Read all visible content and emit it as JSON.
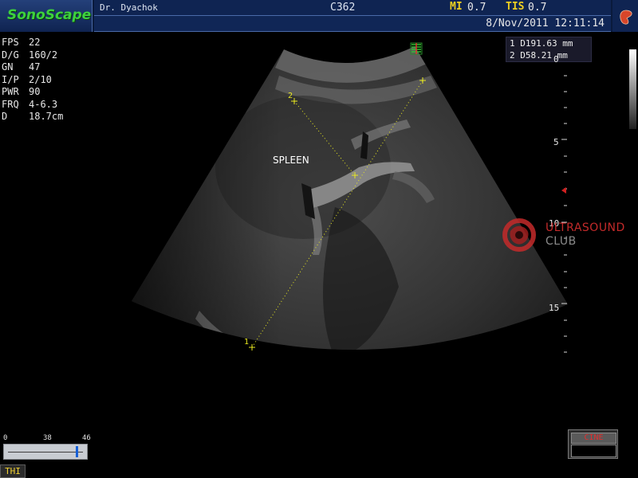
{
  "header": {
    "brand": "SonoScape",
    "doctor": "Dr. Dyachok",
    "probe": "C362",
    "mi_label": "MI",
    "mi_value": "0.7",
    "tis_label": "TIS",
    "tis_value": "0.7",
    "datetime": "8/Nov/2011  12:11:14",
    "app_icon": "kidney-icon"
  },
  "params": [
    {
      "label": "FPS",
      "value": " 22"
    },
    {
      "label": "D/G",
      "value": "160/2"
    },
    {
      "label": "GN",
      "value": "47"
    },
    {
      "label": "I/P",
      "value": "2/10"
    },
    {
      "label": "PWR",
      "value": "90"
    },
    {
      "label": "FRQ",
      "value": "4-6.3"
    },
    {
      "label": "D",
      "value": "18.7cm"
    }
  ],
  "measurements": [
    {
      "label": "1 D191.63 mm"
    },
    {
      "label": "2 D58.21 mm"
    }
  ],
  "image": {
    "organ_label": "SPLEEN",
    "cursor_1": "1",
    "cursor_2": "2",
    "orientation_icon": "probe-orientation-icon"
  },
  "depth_scale": {
    "labels": [
      "0",
      "5",
      "10",
      "15"
    ],
    "focus_color": "#d02020"
  },
  "watermark": {
    "line1": "ULTRASOUND",
    "line2": "CLUB",
    "accent": "#c42a2a"
  },
  "slider": {
    "ticks": [
      "0",
      "38",
      "46"
    ],
    "max": 46,
    "value": 42
  },
  "mode_badge": "THI",
  "cine_label": "CINE",
  "colors": {
    "header_bg": "#0f2452",
    "brand_green": "#3dd23d",
    "index_yellow": "#f0d020",
    "caliper_yellow": "#e8e820"
  }
}
